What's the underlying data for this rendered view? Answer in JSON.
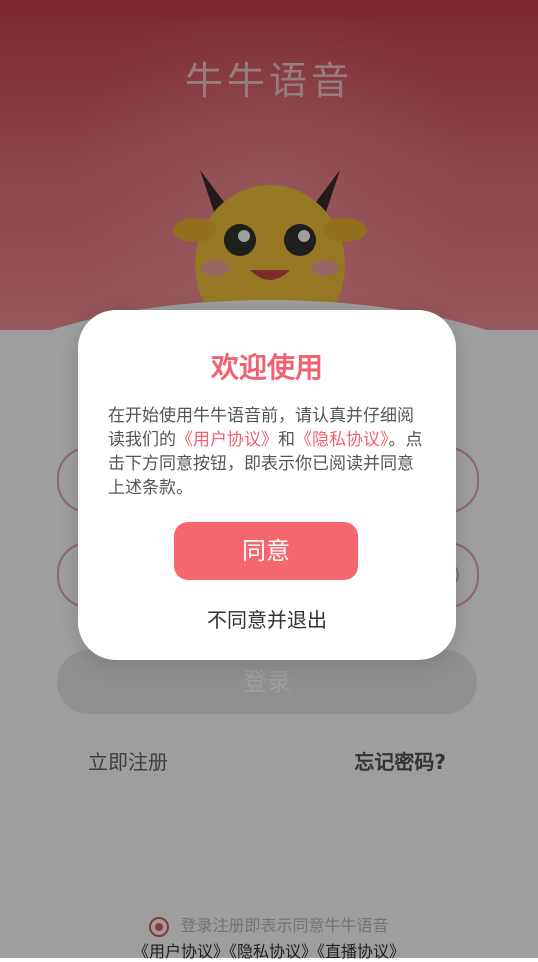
{
  "app": {
    "title": "牛牛语音"
  },
  "login": {
    "login_button": "登录",
    "register_link": "立即注册",
    "forgot_link": "忘记密码?"
  },
  "agreement": {
    "text": "登录注册即表示同意牛牛语音",
    "links": "《用户协议》《隐私协议》《直播协议》"
  },
  "dialog": {
    "title": "欢迎使用",
    "body_part1": "在开始使用牛牛语音前，请认真并仔细阅读我们的",
    "link_user": "《用户协议》",
    "and": "和",
    "link_privacy": "《隐私协议》",
    "body_part2": "。点击下方同意按钮，即表示你已阅读并同意上述条款。",
    "agree_label": "同意",
    "exit_label": "不同意并退出"
  },
  "colors": {
    "brand": "#f06272",
    "agree_button": "#f5676f",
    "header_top": "#c93f4f"
  }
}
